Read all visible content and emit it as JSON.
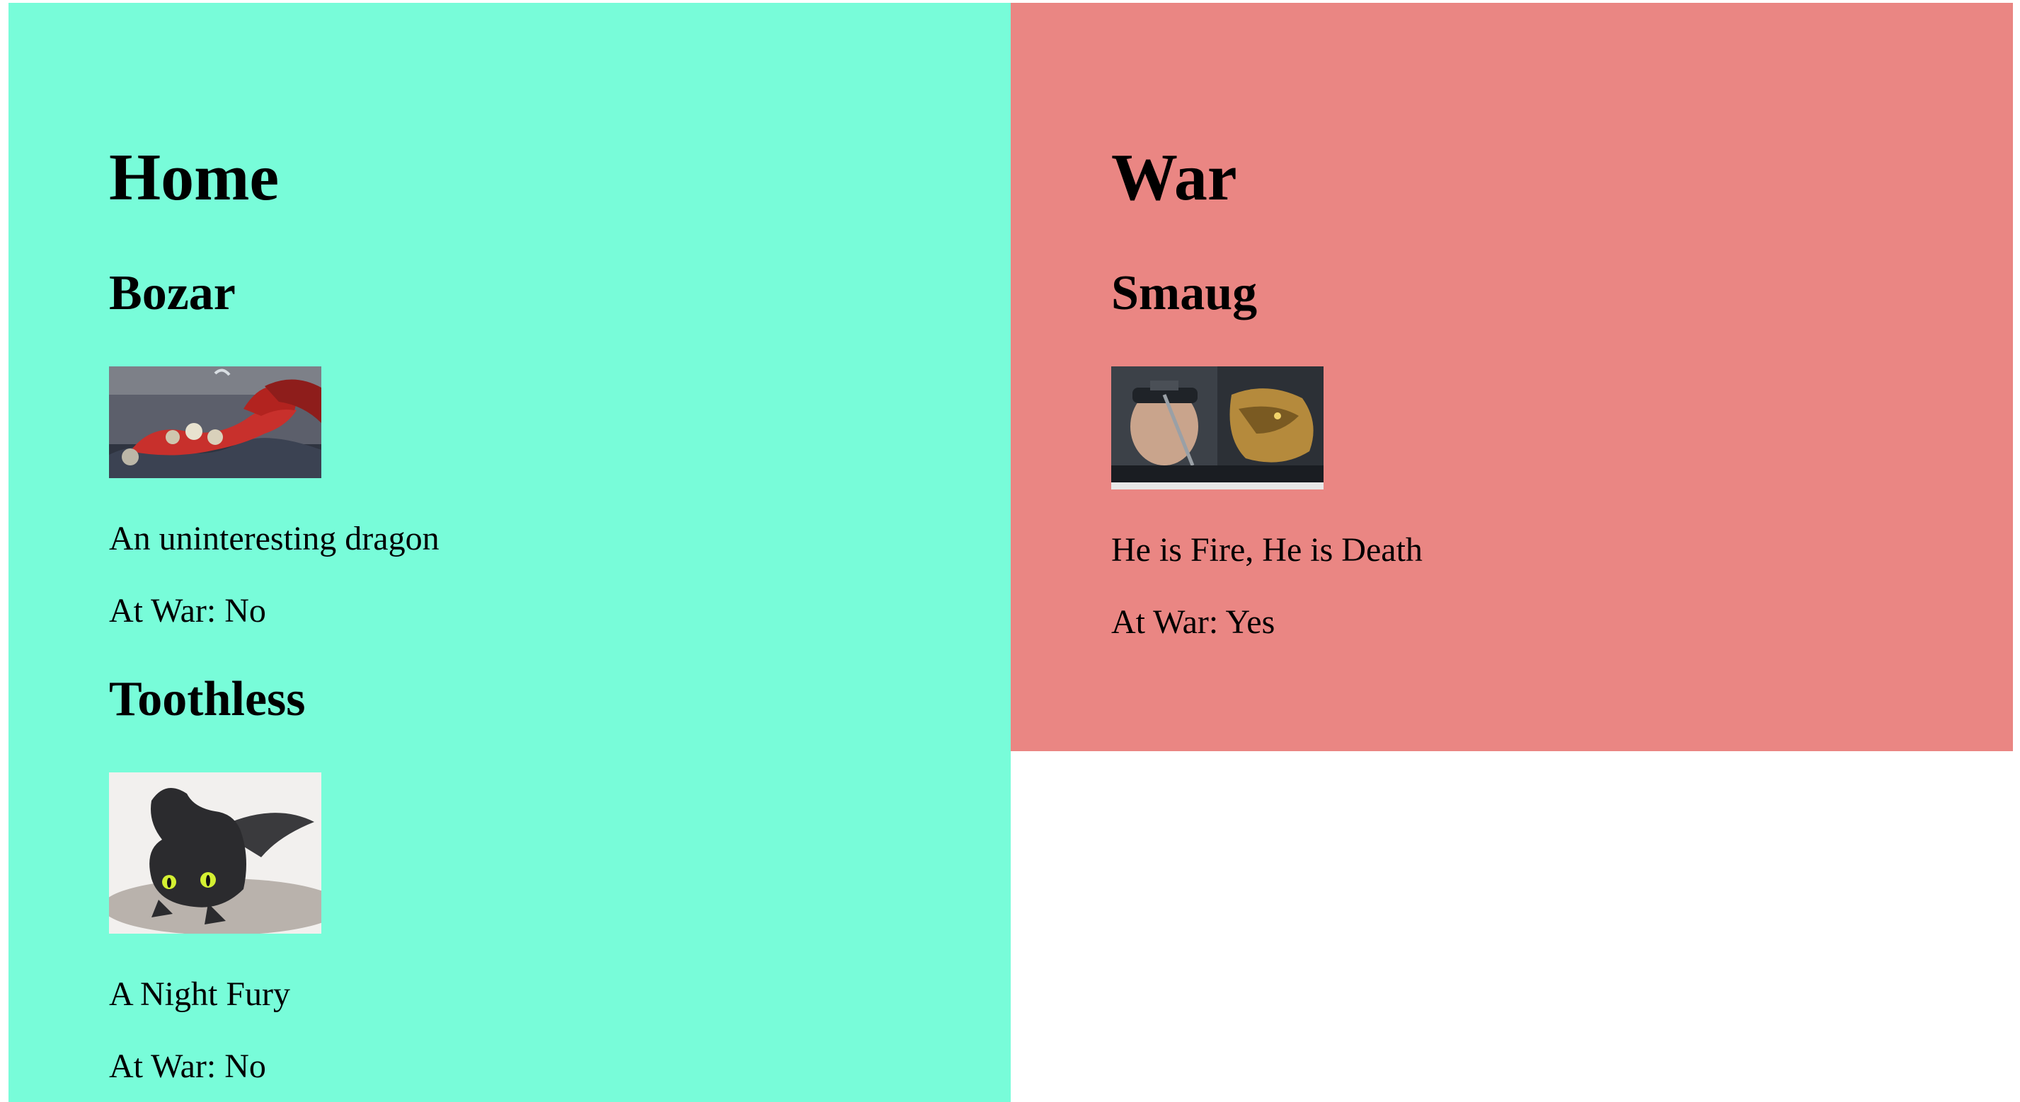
{
  "colors": {
    "home_bg": "#78fcd9",
    "war_bg": "#ea8683",
    "page_bg": "#ffffff"
  },
  "home": {
    "title": "Home",
    "dragons": [
      {
        "name": "Bozar",
        "image": "red-dragon-with-cats-image",
        "description": "An uninteresting dragon",
        "at_war": "At War: No"
      },
      {
        "name": "Toothless",
        "image": "black-night-fury-dragon-image",
        "description": "A Night Fury",
        "at_war": "At War: No"
      }
    ]
  },
  "war": {
    "title": "War",
    "dragons": [
      {
        "name": "Smaug",
        "image": "motion-capture-actor-and-golden-dragon-image",
        "description": "He is Fire, He is Death",
        "at_war": "At War: Yes"
      }
    ]
  }
}
